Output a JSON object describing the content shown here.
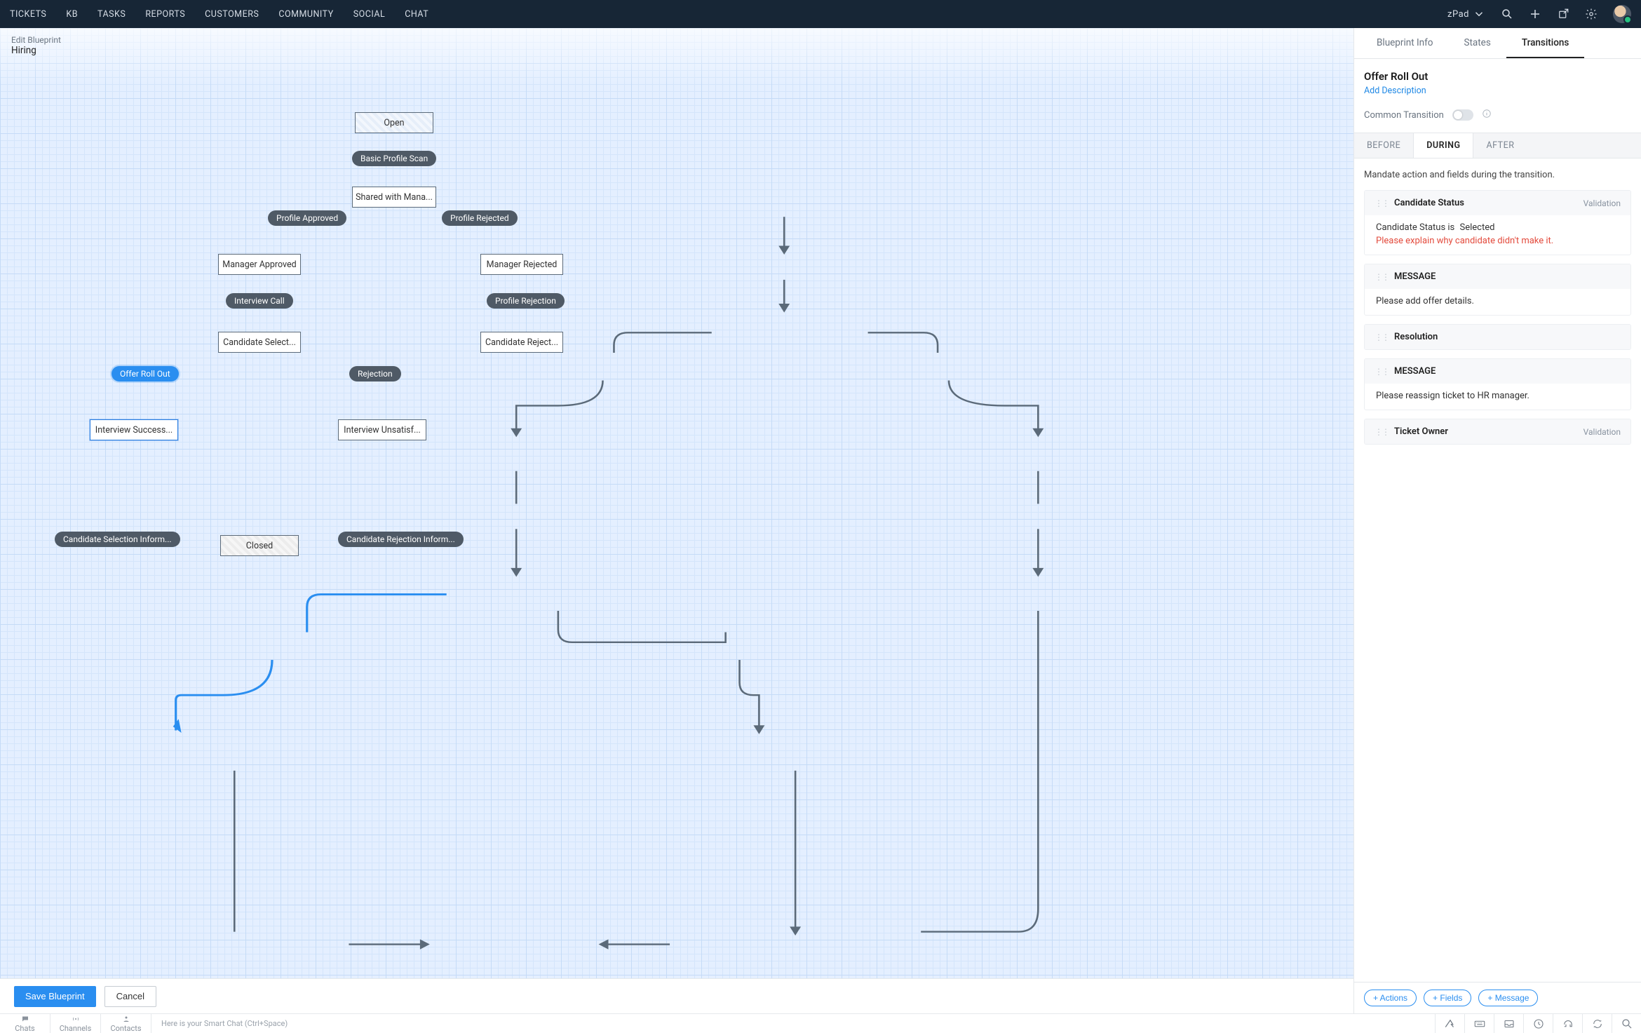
{
  "topnav": {
    "items": [
      "TICKETS",
      "KB",
      "TASKS",
      "REPORTS",
      "CUSTOMERS",
      "COMMUNITY",
      "SOCIAL",
      "CHAT"
    ],
    "workspace": "zPad"
  },
  "header": {
    "subtitle": "Edit Blueprint",
    "title": "Hiring"
  },
  "states": {
    "open": "Open",
    "shared": "Shared with Mana...",
    "mgr_approved": "Manager Approved",
    "mgr_rejected": "Manager Rejected",
    "cand_select": "Candidate Select...",
    "cand_reject": "Candidate Reject...",
    "int_success": "Interview Success...",
    "int_unsat": "Interview Unsatisf...",
    "closed": "Closed"
  },
  "transitions": {
    "basic_scan": "Basic Profile Scan",
    "profile_approved": "Profile Approved",
    "profile_rejected": "Profile Rejected",
    "interview_call": "Interview Call",
    "profile_rejection": "Profile Rejection",
    "offer_rollout": "Offer Roll Out",
    "rejection": "Rejection",
    "cand_sel_inform": "Candidate Selection Inform...",
    "cand_rej_inform": "Candidate Rejection Inform..."
  },
  "savebar": {
    "save": "Save Blueprint",
    "cancel": "Cancel"
  },
  "rightpanel": {
    "tabs": {
      "info": "Blueprint Info",
      "states": "States",
      "transitions": "Transitions"
    },
    "title": "Offer Roll Out",
    "add_desc": "Add Description",
    "common_transition": "Common Transition",
    "phase_tabs": {
      "before": "BEFORE",
      "during": "DURING",
      "after": "AFTER"
    },
    "helper": "Mandate action and fields during the transition.",
    "cards": [
      {
        "title": "Candidate Status",
        "badge": "Validation",
        "line1_a": "Candidate Status is",
        "line1_b": "Selected",
        "error": "Please explain why candidate didn't make it."
      },
      {
        "title": "MESSAGE",
        "body": "Please add offer details."
      },
      {
        "title": "Resolution"
      },
      {
        "title": "MESSAGE",
        "body": "Please reassign ticket to HR manager."
      },
      {
        "title": "Ticket Owner",
        "badge": "Validation"
      }
    ],
    "footer": {
      "actions": "+ Actions",
      "fields": "+ Fields",
      "message": "+ Message"
    }
  },
  "bottombar": {
    "tabs": {
      "chats": "Chats",
      "channels": "Channels",
      "contacts": "Contacts"
    },
    "smartchat": "Here is your Smart Chat (Ctrl+Space)"
  }
}
